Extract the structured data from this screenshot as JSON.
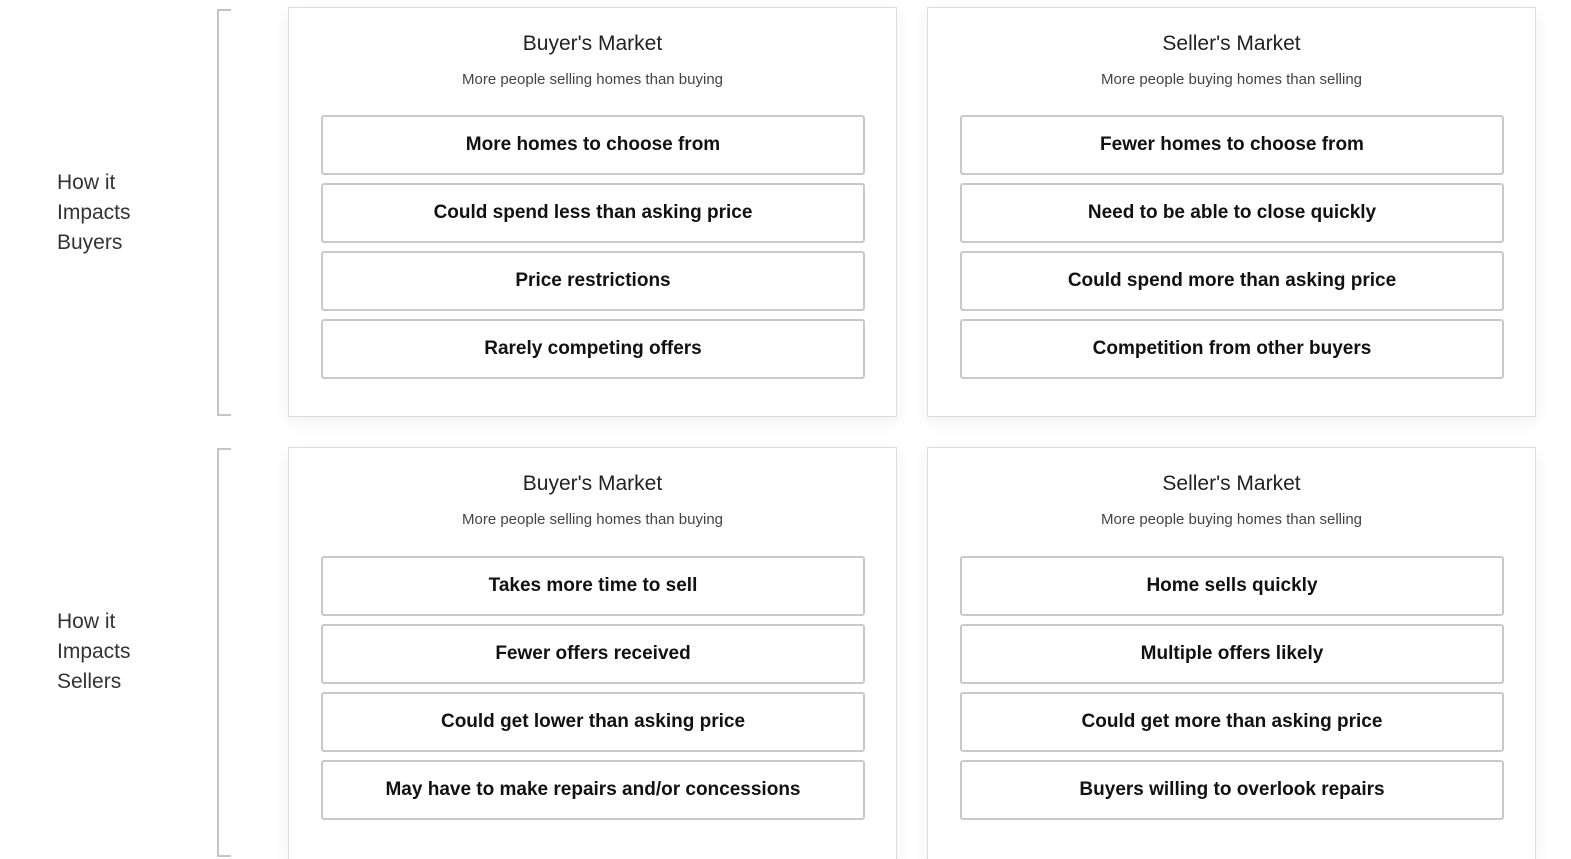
{
  "rows": [
    {
      "label": [
        "How it",
        "Impacts",
        "Buyers"
      ],
      "cards": [
        {
          "title": "Buyer's Market",
          "subtitle": "More people selling homes than buying",
          "items": [
            "More homes to choose from",
            "Could spend less than asking price",
            "Price restrictions",
            "Rarely competing offers"
          ]
        },
        {
          "title": "Seller's Market",
          "subtitle": "More people buying homes than selling",
          "items": [
            "Fewer homes to choose from",
            "Need to be able to close quickly",
            "Could spend more than asking price",
            "Competition from other buyers"
          ]
        }
      ]
    },
    {
      "label": [
        "How it",
        "Impacts",
        "Sellers"
      ],
      "cards": [
        {
          "title": "Buyer's Market",
          "subtitle": "More people selling homes than buying",
          "items": [
            "Takes more time to sell",
            "Fewer offers received",
            "Could get lower than asking price",
            "May have to make repairs and/or concessions"
          ]
        },
        {
          "title": "Seller's Market",
          "subtitle": "More people buying homes than selling",
          "items": [
            "Home sells quickly",
            "Multiple offers likely",
            "Could get more than asking price",
            "Buyers willing to overlook repairs"
          ]
        }
      ]
    }
  ]
}
